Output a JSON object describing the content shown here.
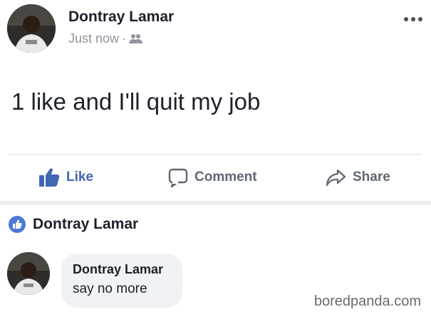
{
  "post": {
    "author": "Dontray Lamar",
    "timestamp": "Just now",
    "separator": "·",
    "audience_icon": "friends-icon",
    "text": "1 like and I'll quit my job",
    "more_icon": "more-options-icon"
  },
  "actions": {
    "like_label": "Like",
    "comment_label": "Comment",
    "share_label": "Share"
  },
  "reaction": {
    "liker_name": "Dontray Lamar",
    "icon": "like-badge-icon"
  },
  "comment": {
    "author": "Dontray Lamar",
    "text": "say no more"
  },
  "watermark": "boredpanda.com",
  "colors": {
    "accent": "#4267b2",
    "muted": "#606770",
    "meta": "#90949c",
    "bubble": "#f0f2f5"
  }
}
